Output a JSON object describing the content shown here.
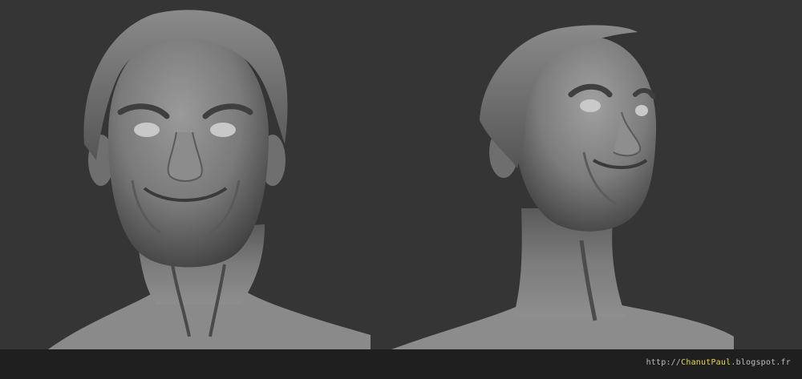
{
  "scene": {
    "background_color": "#353535",
    "footer_color": "#1f1f1f",
    "busts": [
      {
        "label": "front-view-bust"
      },
      {
        "label": "three-quarter-view-bust"
      }
    ]
  },
  "footer": {
    "url_prefix": "http://",
    "url_highlight": "ChanutPaul",
    "url_suffix": ".blogspot.fr",
    "highlight_color": "#e8d64a"
  }
}
